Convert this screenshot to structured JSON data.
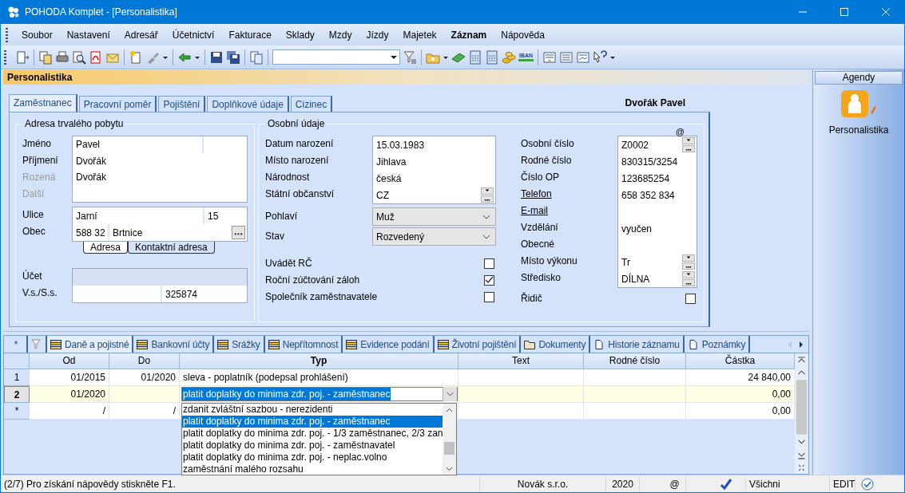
{
  "window": {
    "title": "POHODA Komplet - [Personalistika]"
  },
  "menu": [
    {
      "label": "Soubor",
      "bold": false
    },
    {
      "label": "Nastavení",
      "bold": false
    },
    {
      "label": "Adresář",
      "bold": false
    },
    {
      "label": "Účetnictví",
      "bold": false
    },
    {
      "label": "Fakturace",
      "bold": false
    },
    {
      "label": "Sklady",
      "bold": false
    },
    {
      "label": "Mzdy",
      "bold": false
    },
    {
      "label": "Jízdy",
      "bold": false
    },
    {
      "label": "Majetek",
      "bold": false
    },
    {
      "label": "Záznam",
      "bold": true
    },
    {
      "label": "Nápověda",
      "bold": false
    }
  ],
  "toolbar": {
    "badge": "IBAN"
  },
  "agenda_header": "Personalistika",
  "employee_name": "Dvořák Pavel",
  "tabs": [
    {
      "label": "Zaměstnanec",
      "selected": true
    },
    {
      "label": "Pracovní poměr",
      "selected": false
    },
    {
      "label": "Pojištění",
      "selected": false
    },
    {
      "label": "Doplňkové údaje",
      "selected": false
    },
    {
      "label": "Cizinec",
      "selected": false
    }
  ],
  "address": {
    "legend": "Adresa trvalého pobytu",
    "names": [
      {
        "label": "Jméno",
        "value": "Pavel",
        "disabled": false
      },
      {
        "label": "Příjmení",
        "value": "Dvořák",
        "disabled": false
      },
      {
        "label": "Rozená",
        "value": "Dvořák",
        "disabled": true
      },
      {
        "label": "Další",
        "disabled": true
      }
    ],
    "street": {
      "label": "Ulice",
      "value": "Jarní",
      "number": "15"
    },
    "city": {
      "label": "Obec",
      "zip": "588 32",
      "value": "Brtnice"
    },
    "address_tabs": [
      {
        "label": "Adresa",
        "selected": true
      },
      {
        "label": "Kontaktní adresa",
        "selected": false
      }
    ],
    "account": {
      "label": "Účet"
    },
    "symbols": {
      "label": "V.s./S.s.",
      "value": "325874"
    }
  },
  "personal": {
    "legend": "Osobní údaje",
    "mark": "@",
    "fields": [
      {
        "label": "Datum narození",
        "value": "15.03.1983",
        "kind": "text"
      },
      {
        "label": "Místo narození",
        "value": "Jihlava",
        "kind": "text"
      },
      {
        "label": "Národnost",
        "value": "česká",
        "kind": "text"
      },
      {
        "label": "Státní občanství",
        "value": "CZ",
        "kind": "combo"
      }
    ],
    "selects": [
      {
        "label": "Pohlaví",
        "value": "Muž"
      },
      {
        "label": "Stav",
        "value": "Rozvedený"
      }
    ],
    "checks": [
      {
        "label": "Uvádět RČ",
        "checked": false
      },
      {
        "label": "Roční zúčtování záloh",
        "checked": true
      },
      {
        "label": "Společník zaměstnavatele",
        "checked": false
      }
    ],
    "ids": [
      {
        "label": "Osobní číslo",
        "value": "Z0002",
        "kind": "combo",
        "link": false
      },
      {
        "label": "Rodné číslo",
        "value": "830315/3254",
        "kind": "text",
        "link": false
      },
      {
        "label": "Číslo OP",
        "value": "123685254",
        "kind": "text",
        "link": false
      },
      {
        "label": "Telefon",
        "value": "658 352 834",
        "kind": "text",
        "link": true
      },
      {
        "label": "E-mail",
        "kind": "text",
        "link": true
      },
      {
        "label": "Vzdělání",
        "value": "vyučen",
        "kind": "text",
        "link": false
      },
      {
        "label": "Obecné",
        "kind": "text",
        "link": false
      },
      {
        "label": "Místo výkonu",
        "value": "Tr",
        "kind": "combo",
        "link": false
      },
      {
        "label": "Středisko",
        "value": "DÍLNA",
        "kind": "combo",
        "link": false
      }
    ],
    "driver": {
      "label": "Řidič",
      "checked": false
    }
  },
  "sidebar": {
    "title": "Agendy",
    "items": [
      {
        "label": "Personalistika"
      }
    ]
  },
  "bottom_tabs": [
    {
      "label": "Daně a pojistné",
      "kind": "table",
      "selected": true
    },
    {
      "label": "Bankovní účty",
      "kind": "table",
      "selected": false
    },
    {
      "label": "Srážky",
      "kind": "table",
      "selected": false
    },
    {
      "label": "Nepřítomnost",
      "kind": "table",
      "selected": false
    },
    {
      "label": "Evidence podání",
      "kind": "table",
      "selected": false
    },
    {
      "label": "Životní pojištění",
      "kind": "table",
      "selected": false
    },
    {
      "label": "Dokumenty",
      "kind": "folder",
      "selected": false
    },
    {
      "label": "Historie záznamu",
      "kind": "document",
      "selected": false
    },
    {
      "label": "Poznámky",
      "kind": "document",
      "selected": false
    }
  ],
  "new_record": "*",
  "grid": {
    "columns": [
      "Od",
      "Do",
      "Typ",
      "Text",
      "Rodné číslo",
      "Částka"
    ],
    "rows": [
      {
        "marker": "1",
        "selected": false,
        "cells": [
          "01/2015",
          "01/2020",
          "sleva - poplatník (podepsal prohlášení)",
          null,
          null,
          "24 840,00"
        ]
      },
      {
        "marker": "2",
        "selected": true,
        "cells": [
          "01/2020",
          null,
          null,
          null,
          null,
          "0,00"
        ],
        "combo": {
          "value": "platit doplatky do minima zdr. poj. - zaměstnanec",
          "options": [
            {
              "label": "zdanit zvláštní sazbou - nerezidenti",
              "selected": false
            },
            {
              "label": "platit doplatky do minima zdr. poj. - zaměstnanec",
              "selected": true
            },
            {
              "label": "platit doplatky do minima zdr. poj. - 1/3 zaměstnanec, 2/3 zan",
              "selected": false
            },
            {
              "label": "platit doplatky do minima zdr. poj. - zaměstnavatel",
              "selected": false
            },
            {
              "label": "platit doplatky do minima zdr. poj. - neplac.volno",
              "selected": false
            },
            {
              "label": "zaměstnání malého rozsahu",
              "selected": false
            }
          ]
        }
      },
      {
        "marker": "*",
        "selected": false,
        "cells": [
          "/",
          "/",
          null,
          null,
          null,
          "0,00"
        ]
      }
    ]
  },
  "status_bar": {
    "hint": "(2/7) Pro získání nápovědy stiskněte F1.",
    "company": "Novák s.r.o.",
    "year": "2020",
    "mail": "@",
    "user": "Všichni",
    "mode": "EDIT"
  }
}
